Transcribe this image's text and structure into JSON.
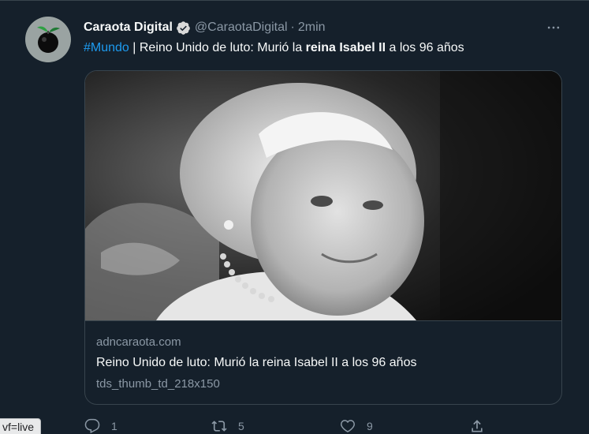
{
  "tweet": {
    "author_name": "Caraota Digital",
    "author_handle": "@CaraotaDigital",
    "separator": "·",
    "timestamp": "2min",
    "verified_icon": "verified-badge-icon",
    "more_icon": "more-options-icon",
    "text": {
      "hashtag": "#Mundo",
      "part1": " | Reino Unido de luto: Murió la ",
      "bold": "reina Isabel II",
      "part2": " a los 96 años"
    }
  },
  "card": {
    "image_desc_icon": "photo-portrait",
    "domain": "adncaraota.com",
    "title": "Reino Unido de luto: Murió la reina Isabel II a los 96 años",
    "description": "tds_thumb_td_218x150"
  },
  "actions": {
    "reply_count": "1",
    "retweet_count": "5",
    "like_count": "9",
    "share_label": ""
  },
  "browser_status": {
    "text": "vf=live"
  },
  "colors": {
    "background": "#15202b",
    "accent": "#1d9bf0",
    "muted": "#8b98a5",
    "border": "#38444d"
  }
}
